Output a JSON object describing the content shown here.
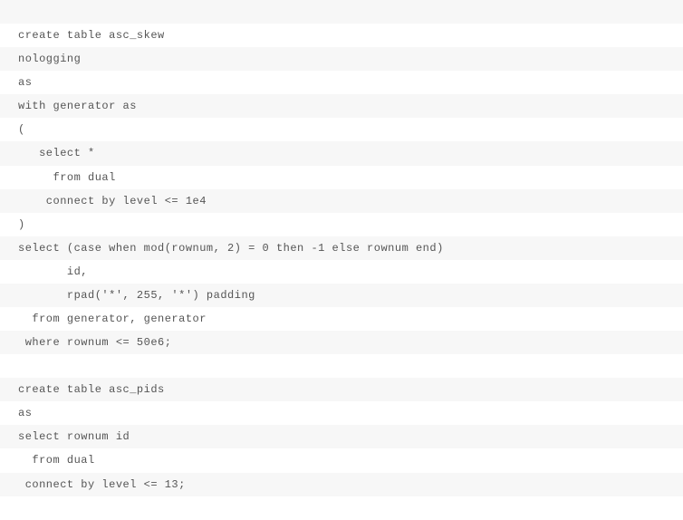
{
  "code": {
    "lines": [
      " ",
      "create table asc_skew",
      "nologging",
      "as",
      "with generator as",
      "(",
      "   select *",
      "     from dual",
      "    connect by level <= 1e4",
      ")",
      "select (case when mod(rownum, 2) = 0 then -1 else rownum end)",
      "       id,",
      "       rpad('*', 255, '*') padding",
      "  from generator, generator",
      " where rownum <= 50e6;",
      " ",
      "create table asc_pids",
      "as",
      "select rownum id",
      "  from dual",
      " connect by level <= 13;",
      " "
    ]
  }
}
